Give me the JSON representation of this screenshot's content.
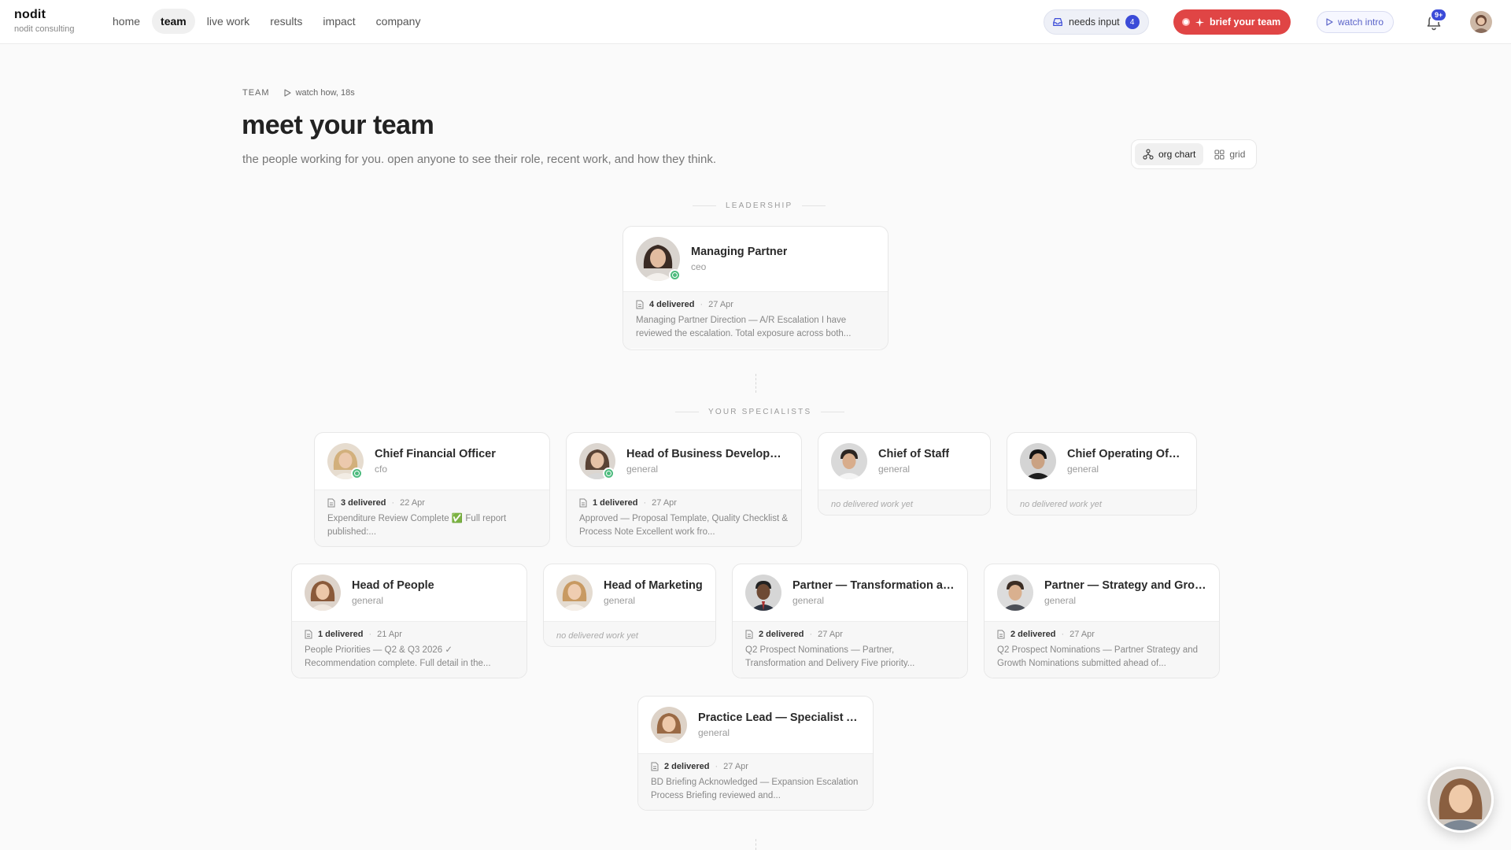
{
  "brand": {
    "name": "nodit",
    "sub": "nodit consulting"
  },
  "nav": [
    {
      "label": "home",
      "active": false
    },
    {
      "label": "team",
      "active": true
    },
    {
      "label": "live work",
      "active": false
    },
    {
      "label": "results",
      "active": false
    },
    {
      "label": "impact",
      "active": false
    },
    {
      "label": "company",
      "active": false
    }
  ],
  "actions": {
    "needs_input_label": "needs input",
    "needs_input_count": "4",
    "brief_label": "brief your team",
    "intro_label": "watch intro",
    "notif_badge": "9+"
  },
  "header": {
    "eyebrow": "TEAM",
    "watch_how": "watch how, 18s",
    "title": "meet your team",
    "subtitle": "the people working for you. open anyone to see their role, recent work, and how they think."
  },
  "view_toggle": {
    "org_chart": "org chart",
    "grid": "grid",
    "selected": "org chart"
  },
  "sections": {
    "leadership": "LEADERSHIP",
    "specialists": "YOUR SPECIALISTS"
  },
  "leader": {
    "title": "Managing Partner",
    "role": "ceo",
    "delivered": "4 delivered",
    "date": "27 Apr",
    "snippet": "Managing Partner Direction — A/R Escalation I have reviewed the escalation. Total exposure across both..."
  },
  "specialists": [
    {
      "title": "Chief Financial Officer",
      "role": "cfo",
      "delivered": "3 delivered",
      "date": "22 Apr",
      "snippet": "Expenditure Review Complete ✅ Full report published:..."
    },
    {
      "title": "Head of Business Development",
      "role": "general",
      "delivered": "1 delivered",
      "date": "27 Apr",
      "snippet": "Approved — Proposal Template, Quality Checklist & Process Note Excellent work fro..."
    },
    {
      "title": "Chief of Staff",
      "role": "general",
      "empty": "no delivered work yet"
    },
    {
      "title": "Chief Operating Officer",
      "role": "general",
      "empty": "no delivered work yet"
    },
    {
      "title": "Head of People",
      "role": "general",
      "delivered": "1 delivered",
      "date": "21 Apr",
      "snippet": "People Priorities — Q2 & Q3 2026 ✓ Recommendation complete. Full detail in the..."
    },
    {
      "title": "Head of Marketing",
      "role": "general",
      "empty": "no delivered work yet"
    },
    {
      "title": "Partner — Transformation and...",
      "role": "general",
      "delivered": "2 delivered",
      "date": "27 Apr",
      "snippet": "Q2 Prospect Nominations — Partner, Transformation and Delivery Five priority..."
    },
    {
      "title": "Partner — Strategy and Growth",
      "role": "general",
      "delivered": "2 delivered",
      "date": "27 Apr",
      "snippet": "Q2 Prospect Nominations — Partner Strategy and Growth Nominations submitted ahead of..."
    },
    {
      "title": "Practice Lead — Specialist Ad...",
      "role": "general",
      "delivered": "2 delivered",
      "date": "27 Apr",
      "snippet": "BD Briefing Acknowledged — Expansion Escalation Process Briefing reviewed and..."
    }
  ],
  "colors": {
    "accent": "#3b4bd8",
    "brief": "#e04545",
    "online": "#4dbb7e"
  }
}
